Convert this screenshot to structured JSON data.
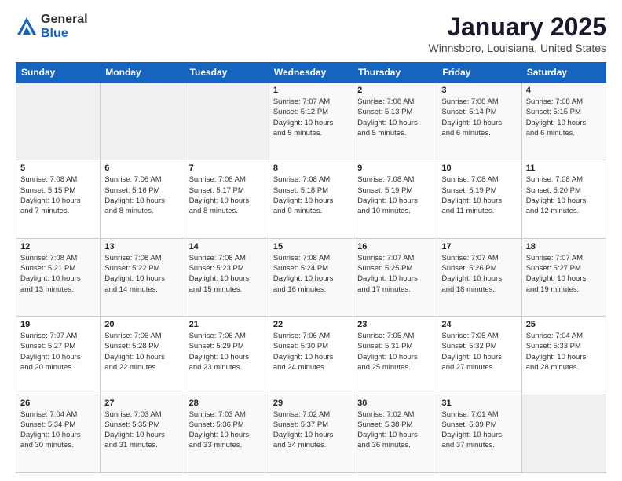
{
  "logo": {
    "general": "General",
    "blue": "Blue"
  },
  "title": "January 2025",
  "location": "Winnsboro, Louisiana, United States",
  "days_of_week": [
    "Sunday",
    "Monday",
    "Tuesday",
    "Wednesday",
    "Thursday",
    "Friday",
    "Saturday"
  ],
  "weeks": [
    [
      {
        "num": "",
        "info": ""
      },
      {
        "num": "",
        "info": ""
      },
      {
        "num": "",
        "info": ""
      },
      {
        "num": "1",
        "info": "Sunrise: 7:07 AM\nSunset: 5:12 PM\nDaylight: 10 hours\nand 5 minutes."
      },
      {
        "num": "2",
        "info": "Sunrise: 7:08 AM\nSunset: 5:13 PM\nDaylight: 10 hours\nand 5 minutes."
      },
      {
        "num": "3",
        "info": "Sunrise: 7:08 AM\nSunset: 5:14 PM\nDaylight: 10 hours\nand 6 minutes."
      },
      {
        "num": "4",
        "info": "Sunrise: 7:08 AM\nSunset: 5:15 PM\nDaylight: 10 hours\nand 6 minutes."
      }
    ],
    [
      {
        "num": "5",
        "info": "Sunrise: 7:08 AM\nSunset: 5:15 PM\nDaylight: 10 hours\nand 7 minutes."
      },
      {
        "num": "6",
        "info": "Sunrise: 7:08 AM\nSunset: 5:16 PM\nDaylight: 10 hours\nand 8 minutes."
      },
      {
        "num": "7",
        "info": "Sunrise: 7:08 AM\nSunset: 5:17 PM\nDaylight: 10 hours\nand 8 minutes."
      },
      {
        "num": "8",
        "info": "Sunrise: 7:08 AM\nSunset: 5:18 PM\nDaylight: 10 hours\nand 9 minutes."
      },
      {
        "num": "9",
        "info": "Sunrise: 7:08 AM\nSunset: 5:19 PM\nDaylight: 10 hours\nand 10 minutes."
      },
      {
        "num": "10",
        "info": "Sunrise: 7:08 AM\nSunset: 5:19 PM\nDaylight: 10 hours\nand 11 minutes."
      },
      {
        "num": "11",
        "info": "Sunrise: 7:08 AM\nSunset: 5:20 PM\nDaylight: 10 hours\nand 12 minutes."
      }
    ],
    [
      {
        "num": "12",
        "info": "Sunrise: 7:08 AM\nSunset: 5:21 PM\nDaylight: 10 hours\nand 13 minutes."
      },
      {
        "num": "13",
        "info": "Sunrise: 7:08 AM\nSunset: 5:22 PM\nDaylight: 10 hours\nand 14 minutes."
      },
      {
        "num": "14",
        "info": "Sunrise: 7:08 AM\nSunset: 5:23 PM\nDaylight: 10 hours\nand 15 minutes."
      },
      {
        "num": "15",
        "info": "Sunrise: 7:08 AM\nSunset: 5:24 PM\nDaylight: 10 hours\nand 16 minutes."
      },
      {
        "num": "16",
        "info": "Sunrise: 7:07 AM\nSunset: 5:25 PM\nDaylight: 10 hours\nand 17 minutes."
      },
      {
        "num": "17",
        "info": "Sunrise: 7:07 AM\nSunset: 5:26 PM\nDaylight: 10 hours\nand 18 minutes."
      },
      {
        "num": "18",
        "info": "Sunrise: 7:07 AM\nSunset: 5:27 PM\nDaylight: 10 hours\nand 19 minutes."
      }
    ],
    [
      {
        "num": "19",
        "info": "Sunrise: 7:07 AM\nSunset: 5:27 PM\nDaylight: 10 hours\nand 20 minutes."
      },
      {
        "num": "20",
        "info": "Sunrise: 7:06 AM\nSunset: 5:28 PM\nDaylight: 10 hours\nand 22 minutes."
      },
      {
        "num": "21",
        "info": "Sunrise: 7:06 AM\nSunset: 5:29 PM\nDaylight: 10 hours\nand 23 minutes."
      },
      {
        "num": "22",
        "info": "Sunrise: 7:06 AM\nSunset: 5:30 PM\nDaylight: 10 hours\nand 24 minutes."
      },
      {
        "num": "23",
        "info": "Sunrise: 7:05 AM\nSunset: 5:31 PM\nDaylight: 10 hours\nand 25 minutes."
      },
      {
        "num": "24",
        "info": "Sunrise: 7:05 AM\nSunset: 5:32 PM\nDaylight: 10 hours\nand 27 minutes."
      },
      {
        "num": "25",
        "info": "Sunrise: 7:04 AM\nSunset: 5:33 PM\nDaylight: 10 hours\nand 28 minutes."
      }
    ],
    [
      {
        "num": "26",
        "info": "Sunrise: 7:04 AM\nSunset: 5:34 PM\nDaylight: 10 hours\nand 30 minutes."
      },
      {
        "num": "27",
        "info": "Sunrise: 7:03 AM\nSunset: 5:35 PM\nDaylight: 10 hours\nand 31 minutes."
      },
      {
        "num": "28",
        "info": "Sunrise: 7:03 AM\nSunset: 5:36 PM\nDaylight: 10 hours\nand 33 minutes."
      },
      {
        "num": "29",
        "info": "Sunrise: 7:02 AM\nSunset: 5:37 PM\nDaylight: 10 hours\nand 34 minutes."
      },
      {
        "num": "30",
        "info": "Sunrise: 7:02 AM\nSunset: 5:38 PM\nDaylight: 10 hours\nand 36 minutes."
      },
      {
        "num": "31",
        "info": "Sunrise: 7:01 AM\nSunset: 5:39 PM\nDaylight: 10 hours\nand 37 minutes."
      },
      {
        "num": "",
        "info": ""
      }
    ]
  ]
}
